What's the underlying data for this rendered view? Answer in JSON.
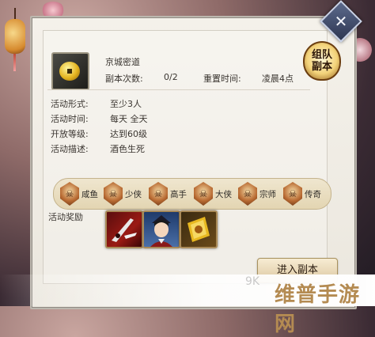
{
  "window": {
    "close_glyph": "✕"
  },
  "team_badge": {
    "line1": "组队",
    "line2": "副本"
  },
  "dungeon": {
    "name": "京城密道",
    "attempts_label": "副本次数:",
    "attempts_value": "0/2",
    "reset_label": "重置时间:",
    "reset_value": "凌晨4点"
  },
  "info": [
    {
      "label": "活动形式:",
      "value": "至少3人"
    },
    {
      "label": "活动时间:",
      "value": "每天 全天"
    },
    {
      "label": "开放等级:",
      "value": "达到60级"
    },
    {
      "label": "活动描述:",
      "value": "酒色生死"
    }
  ],
  "ranks": [
    {
      "glyph": "☠",
      "label": "咸鱼"
    },
    {
      "glyph": "☠",
      "label": "少侠"
    },
    {
      "glyph": "☠",
      "label": "高手"
    },
    {
      "glyph": "☠",
      "label": "大侠"
    },
    {
      "glyph": "☠",
      "label": "宗师"
    },
    {
      "glyph": "☠",
      "label": "传奇"
    }
  ],
  "rewards": {
    "label": "活动奖励",
    "items": [
      {
        "icon": "blade-icon"
      },
      {
        "icon": "character-portrait-icon"
      },
      {
        "icon": "golden-scroll-icon"
      }
    ]
  },
  "enter_button": "进入副本",
  "watermark": {
    "text": "维普手游网",
    "faint": "9K"
  },
  "colors": {
    "panel_bg": "#f4f1ea",
    "rank_bar": "#e3d5b2",
    "button": "#dcc7a0",
    "watermark": "#b48b52"
  }
}
